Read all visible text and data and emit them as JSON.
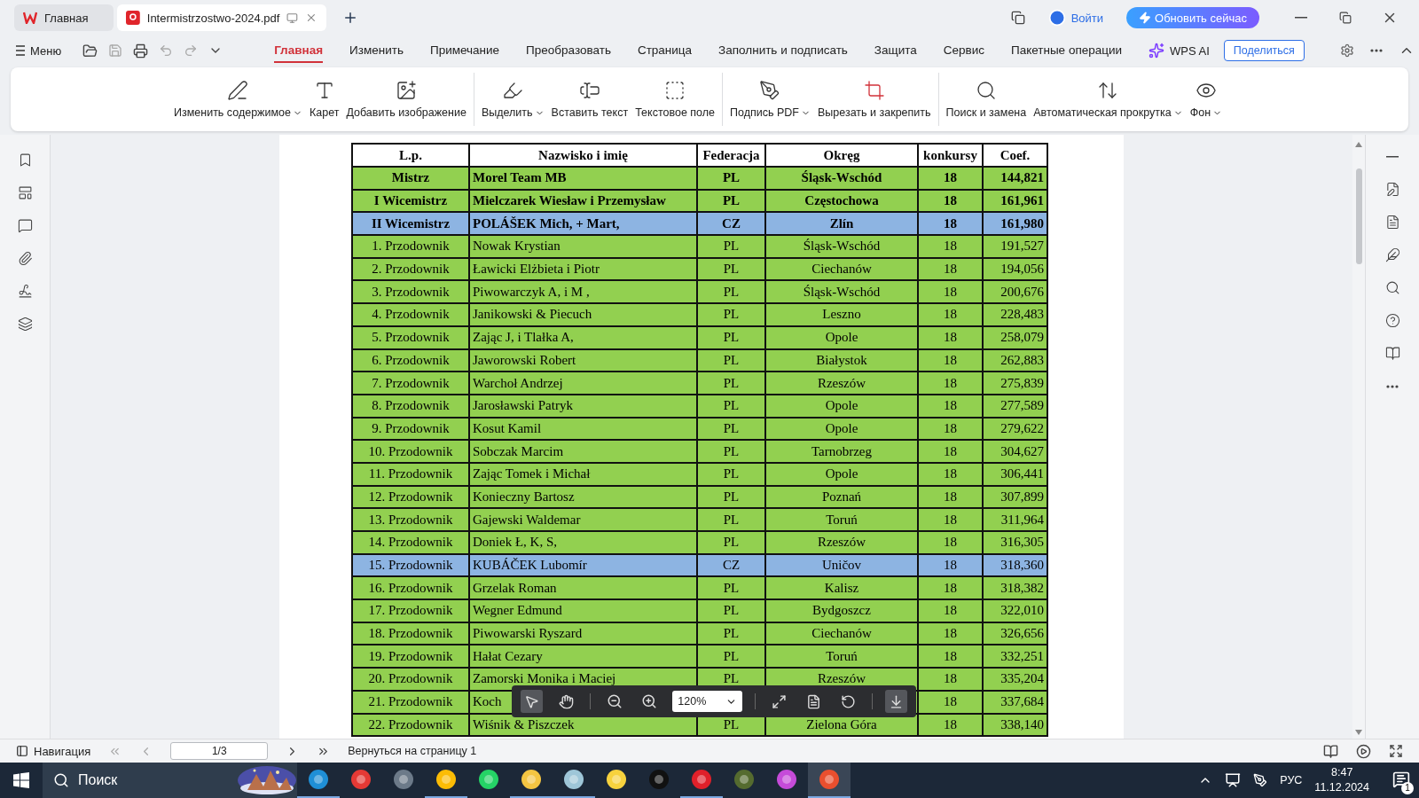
{
  "tabs": [
    {
      "label": "Главная",
      "selected": false
    },
    {
      "label": "Intermistrzostwo-2024.pdf",
      "selected": true
    }
  ],
  "account": {
    "login": "Войти",
    "upgrade": "Обновить сейчас"
  },
  "menu_button": "Меню",
  "ribbon_tabs": [
    {
      "label": "Главная",
      "selected": true
    },
    {
      "label": "Изменить",
      "selected": false
    },
    {
      "label": "Примечание",
      "selected": false
    },
    {
      "label": "Преобразовать",
      "selected": false
    },
    {
      "label": "Страница",
      "selected": false
    },
    {
      "label": "Заполнить и подписать",
      "selected": false
    },
    {
      "label": "Защита",
      "selected": false
    },
    {
      "label": "Сервис",
      "selected": false
    },
    {
      "label": "Пакетные операции",
      "selected": false
    }
  ],
  "wps_ai": "WPS AI",
  "share": "Поделиться",
  "tool_groups": [
    [
      {
        "label": "Изменить содержимое",
        "dropdown": true
      },
      {
        "label": "Карет",
        "dropdown": false
      },
      {
        "label": "Добавить изображение",
        "dropdown": false
      }
    ],
    [
      {
        "label": "Выделить",
        "dropdown": true
      },
      {
        "label": "Вставить текст",
        "dropdown": false
      },
      {
        "label": "Текстовое поле",
        "dropdown": false
      }
    ],
    [
      {
        "label": "Подпись PDF",
        "dropdown": true
      },
      {
        "label": "Вырезать и закрепить",
        "dropdown": false
      }
    ],
    [
      {
        "label": "Поиск и замена",
        "dropdown": false
      },
      {
        "label": "Автоматическая прокрутка",
        "dropdown": true
      },
      {
        "label": "Фон",
        "dropdown": true
      }
    ]
  ],
  "table": {
    "columns": [
      "L.p.",
      "Nazwisko i imię",
      "Federacja",
      "Okręg",
      "konkursy",
      "Coef."
    ],
    "rows": [
      {
        "cells": [
          "Mistrz",
          "Morel Team MB",
          "PL",
          "Śląsk-Wschód",
          "18",
          "144,821"
        ],
        "color": "#92d050",
        "bold": true
      },
      {
        "cells": [
          "I Wicemistrz",
          "Mielczarek Wiesław i Przemysław",
          "PL",
          "Częstochowa",
          "18",
          "161,961"
        ],
        "color": "#92d050",
        "bold": true
      },
      {
        "cells": [
          "II Wicemistrz",
          "POLÁŠEK Mich, + Mart,",
          "CZ",
          "Zlín",
          "18",
          "161,980"
        ],
        "color": "#8db4e2",
        "bold": true
      },
      {
        "cells": [
          "1. Przodownik",
          "Nowak Krystian",
          "PL",
          "Śląsk-Wschód",
          "18",
          "191,527"
        ],
        "color": "#92d050",
        "bold": false
      },
      {
        "cells": [
          "2. Przodownik",
          "Ławicki Elżbieta i Piotr",
          "PL",
          "Ciechanów",
          "18",
          "194,056"
        ],
        "color": "#92d050",
        "bold": false
      },
      {
        "cells": [
          "3. Przodownik",
          "Piwowarczyk A, i M ,",
          "PL",
          "Śląsk-Wschód",
          "18",
          "200,676"
        ],
        "color": "#92d050",
        "bold": false
      },
      {
        "cells": [
          "4. Przodownik",
          "Janikowski & Piecuch",
          "PL",
          "Leszno",
          "18",
          "228,483"
        ],
        "color": "#92d050",
        "bold": false
      },
      {
        "cells": [
          "5. Przodownik",
          "Zając J, i Tlałka A,",
          "PL",
          "Opole",
          "18",
          "258,079"
        ],
        "color": "#92d050",
        "bold": false
      },
      {
        "cells": [
          "6. Przodownik",
          "Jaworowski Robert",
          "PL",
          "Białystok",
          "18",
          "262,883"
        ],
        "color": "#92d050",
        "bold": false
      },
      {
        "cells": [
          "7. Przodownik",
          "Warchoł Andrzej",
          "PL",
          "Rzeszów",
          "18",
          "275,839"
        ],
        "color": "#92d050",
        "bold": false
      },
      {
        "cells": [
          "8. Przodownik",
          "Jarosławski Patryk",
          "PL",
          "Opole",
          "18",
          "277,589"
        ],
        "color": "#92d050",
        "bold": false
      },
      {
        "cells": [
          "9. Przodownik",
          "Kosut Kamil",
          "PL",
          "Opole",
          "18",
          "279,622"
        ],
        "color": "#92d050",
        "bold": false
      },
      {
        "cells": [
          "10. Przodownik",
          "Sobczak Marcim",
          "PL",
          "Tarnobrzeg",
          "18",
          "304,627"
        ],
        "color": "#92d050",
        "bold": false
      },
      {
        "cells": [
          "11. Przodownik",
          "Zając Tomek i Michał",
          "PL",
          "Opole",
          "18",
          "306,441"
        ],
        "color": "#92d050",
        "bold": false
      },
      {
        "cells": [
          "12. Przodownik",
          "Konieczny Bartosz",
          "PL",
          "Poznań",
          "18",
          "307,899"
        ],
        "color": "#92d050",
        "bold": false
      },
      {
        "cells": [
          "13. Przodownik",
          "Gajewski Waldemar",
          "PL",
          "Toruń",
          "18",
          "311,964"
        ],
        "color": "#92d050",
        "bold": false
      },
      {
        "cells": [
          "14. Przodownik",
          "Doniek Ł, K, S,",
          "PL",
          "Rzeszów",
          "18",
          "316,305"
        ],
        "color": "#92d050",
        "bold": false
      },
      {
        "cells": [
          "15. Przodownik",
          "KUBÁČEK Lubomír",
          "CZ",
          "Uničov",
          "18",
          "318,360"
        ],
        "color": "#8db4e2",
        "bold": false
      },
      {
        "cells": [
          "16. Przodownik",
          "Grzelak Roman",
          "PL",
          "Kalisz",
          "18",
          "318,382"
        ],
        "color": "#92d050",
        "bold": false
      },
      {
        "cells": [
          "17. Przodownik",
          "Wegner  Edmund",
          "PL",
          "Bydgoszcz",
          "18",
          "322,010"
        ],
        "color": "#92d050",
        "bold": false
      },
      {
        "cells": [
          "18. Przodownik",
          "Piwowarski Ryszard",
          "PL",
          "Ciechanów",
          "18",
          "326,656"
        ],
        "color": "#92d050",
        "bold": false
      },
      {
        "cells": [
          "19. Przodownik",
          "Hałat Cezary",
          "PL",
          "Toruń",
          "18",
          "332,251"
        ],
        "color": "#92d050",
        "bold": false
      },
      {
        "cells": [
          "20. Przodownik",
          "Zamorski Monika i Maciej",
          "PL",
          "Rzeszów",
          "18",
          "335,204"
        ],
        "color": "#92d050",
        "bold": false
      },
      {
        "cells": [
          "21. Przodownik",
          "Koch",
          "",
          "",
          "18",
          "337,684"
        ],
        "color": "#92d050",
        "bold": false
      },
      {
        "cells": [
          "22. Przodownik",
          "Wiśnik & Piszczek",
          "PL",
          "Zielona Góra",
          "18",
          "338,140"
        ],
        "color": "#92d050",
        "bold": false
      }
    ]
  },
  "zoom_toolbar": {
    "zoom": "120%"
  },
  "status_bar": {
    "navigation": "Навигация",
    "page": "1/3",
    "back": "Вернуться на страницу 1"
  },
  "taskbar": {
    "search_placeholder": "Поиск",
    "language": "РУС",
    "time": "8:47",
    "date": "11.12.2024",
    "notifications": "1"
  }
}
